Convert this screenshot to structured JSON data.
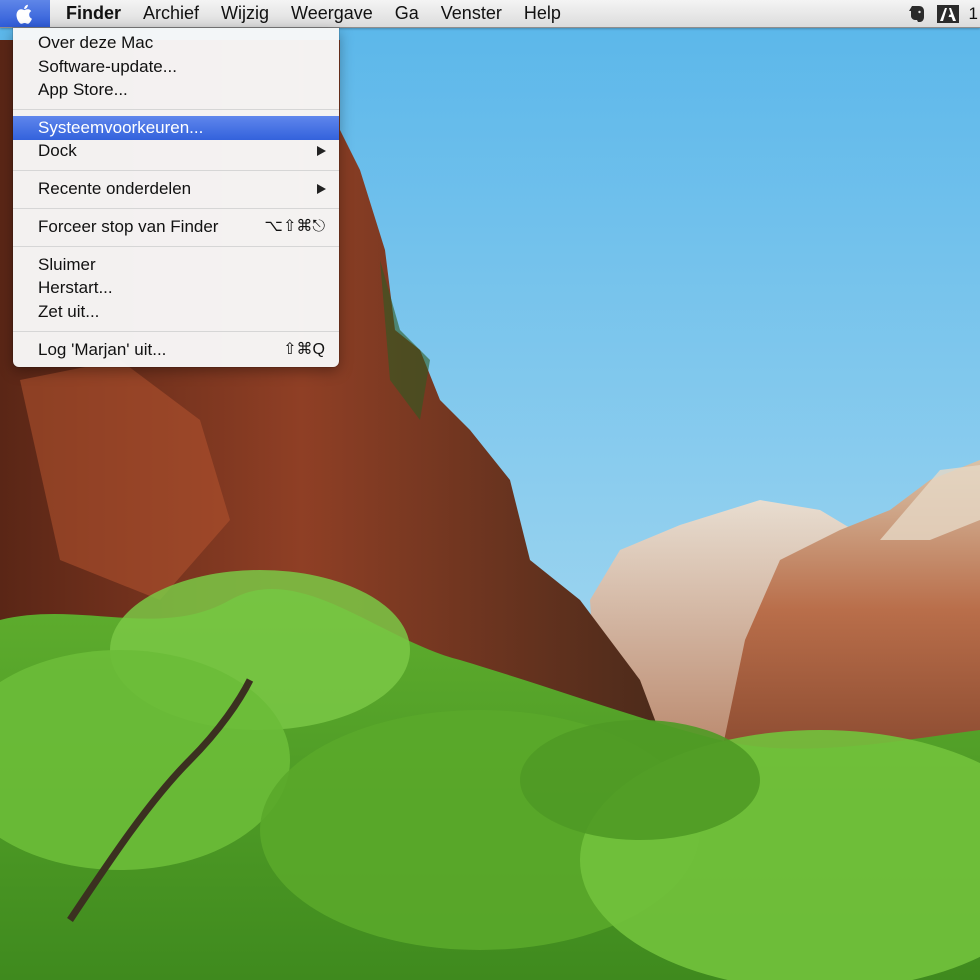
{
  "menubar": {
    "apple_icon": "apple-logo-icon",
    "app_name": "Finder",
    "menus": [
      "Archief",
      "Wijzig",
      "Weergave",
      "Ga",
      "Venster",
      "Help"
    ],
    "status": {
      "evernote_icon": "evernote-elephant-icon",
      "adobe_icon": "adobe-icon",
      "clipped_text": "1"
    }
  },
  "apple_menu": {
    "items": [
      {
        "label": "Over deze Mac"
      },
      {
        "label": "Software-update..."
      },
      {
        "label": "App Store..."
      },
      {
        "label": "Systeemvoorkeuren...",
        "highlighted": true
      },
      {
        "label": "Dock",
        "submenu": true
      },
      {
        "label": "Recente onderdelen",
        "submenu": true
      },
      {
        "label": "Forceer stop van Finder",
        "shortcut": "⌥⇧⌘⎋"
      },
      {
        "label": "Sluimer"
      },
      {
        "label": "Herstart..."
      },
      {
        "label": "Zet uit..."
      },
      {
        "label": "Log 'Marjan' uit...",
        "shortcut": "⇧⌘Q"
      }
    ]
  },
  "colors": {
    "highlight": "#3a66de",
    "menubar": "#e8e8e8",
    "sky": "#7fc4ea",
    "foliage": "#6bb83a",
    "rock": "#9c4a2e"
  }
}
